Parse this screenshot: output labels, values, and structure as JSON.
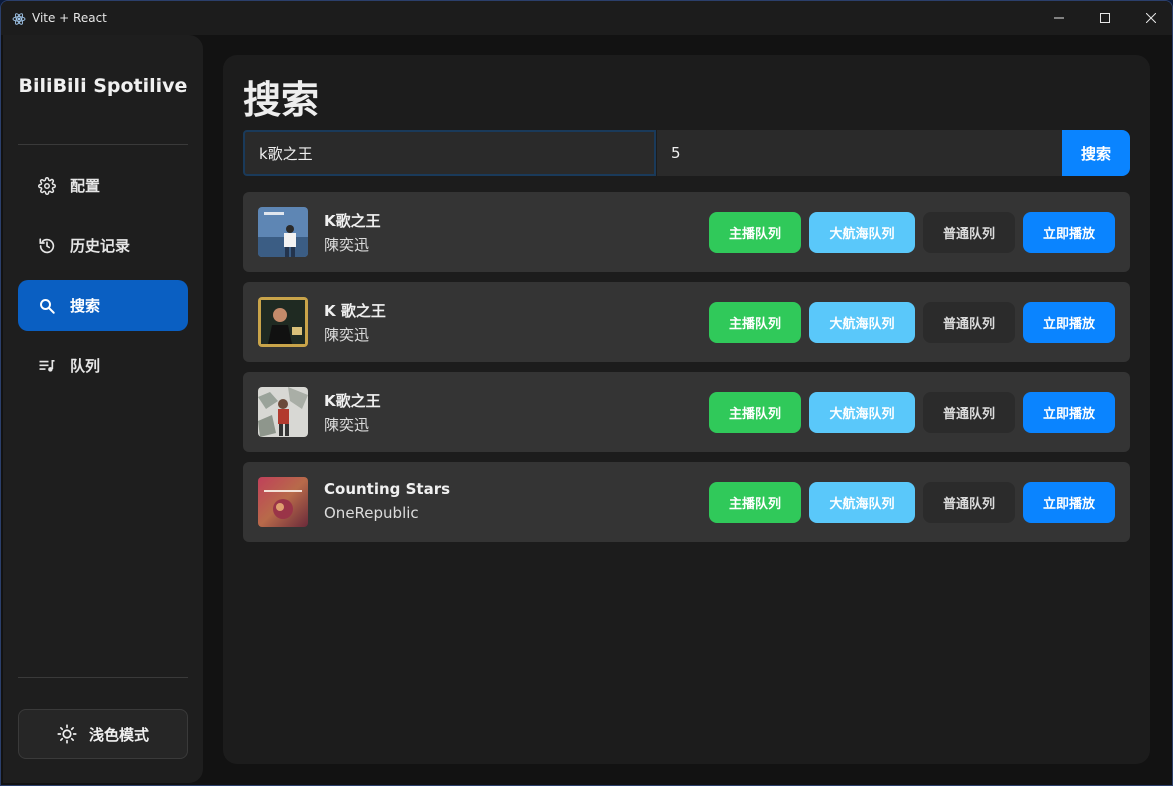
{
  "window": {
    "title": "Vite + React",
    "controls": [
      "minimize",
      "maximize",
      "close"
    ]
  },
  "sidebar": {
    "brand": "BiliBili Spotilive",
    "items": [
      {
        "label": "配置",
        "icon": "gear-icon",
        "active": false
      },
      {
        "label": "历史记录",
        "icon": "history-icon",
        "active": false
      },
      {
        "label": "搜索",
        "icon": "search-icon",
        "active": true
      },
      {
        "label": "队列",
        "icon": "queue-music-icon",
        "active": false
      }
    ],
    "theme_toggle": {
      "label": "浅色模式",
      "icon": "sun-icon"
    }
  },
  "main": {
    "title": "搜索",
    "search": {
      "query": "k歌之王",
      "count": "5",
      "button": "搜索"
    },
    "actions": {
      "main_queue": "主播队列",
      "voyage_queue": "大航海队列",
      "normal_queue": "普通队列",
      "play_now": "立即播放"
    },
    "results": [
      {
        "title": "K歌之王",
        "artist": "陳奕迅"
      },
      {
        "title": "K 歌之王",
        "artist": "陳奕迅"
      },
      {
        "title": "K歌之王",
        "artist": "陳奕迅"
      },
      {
        "title": "Counting Stars",
        "artist": "OneRepublic"
      }
    ]
  },
  "colors": {
    "accent": "#0a84ff",
    "active_nav": "#0a5fc2",
    "green": "#30c95a",
    "light_blue": "#5ac8fa",
    "card": "#343434",
    "panel": "#1c1c1c"
  }
}
